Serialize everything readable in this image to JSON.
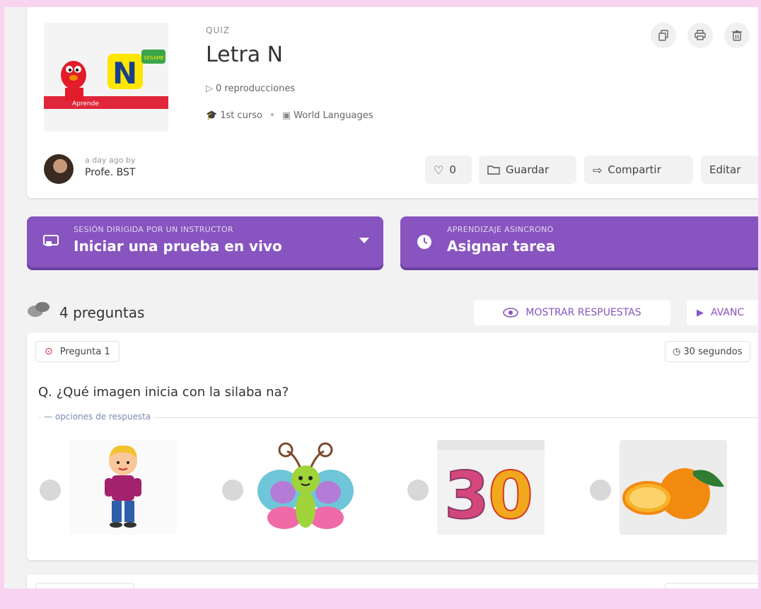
{
  "header": {
    "type_label": "QUIZ",
    "title": "Letra N",
    "plays": "0 reproducciones",
    "grade": "1st curso",
    "subject": "World Languages",
    "thumbnail": {
      "badge_text": "Aprende",
      "logo_text": "SESAME"
    }
  },
  "author": {
    "ago": "a day ago by",
    "name": "Profe. BST"
  },
  "actions": {
    "like_count": "0",
    "save_label": "Guardar",
    "share_label": "Compartir",
    "edit_label": "Editar"
  },
  "session": {
    "live": {
      "small_label": "SESIÓN DIRIGIDA POR UN INSTRUCTOR",
      "label": "Iniciar una prueba en vivo"
    },
    "async": {
      "small_label": "APRENDIZAJE ASINCRONO",
      "label": "Asignar tarea"
    }
  },
  "questions": {
    "count_label": "4 preguntas",
    "show_answers_label": "MOSTRAR RESPUESTAS",
    "advanced_label": "AVANC"
  },
  "question1": {
    "label": "Pregunta 1",
    "time": "30 segundos",
    "text": "Q. ¿Qué imagen inicia con la silaba na?",
    "options_legend": "opciones de respuesta",
    "options": [
      "boy-image",
      "butterfly-image",
      "number-30-image",
      "orange-image"
    ]
  },
  "colors": {
    "accent": "#8854c0",
    "background": "#f9d4f0"
  }
}
